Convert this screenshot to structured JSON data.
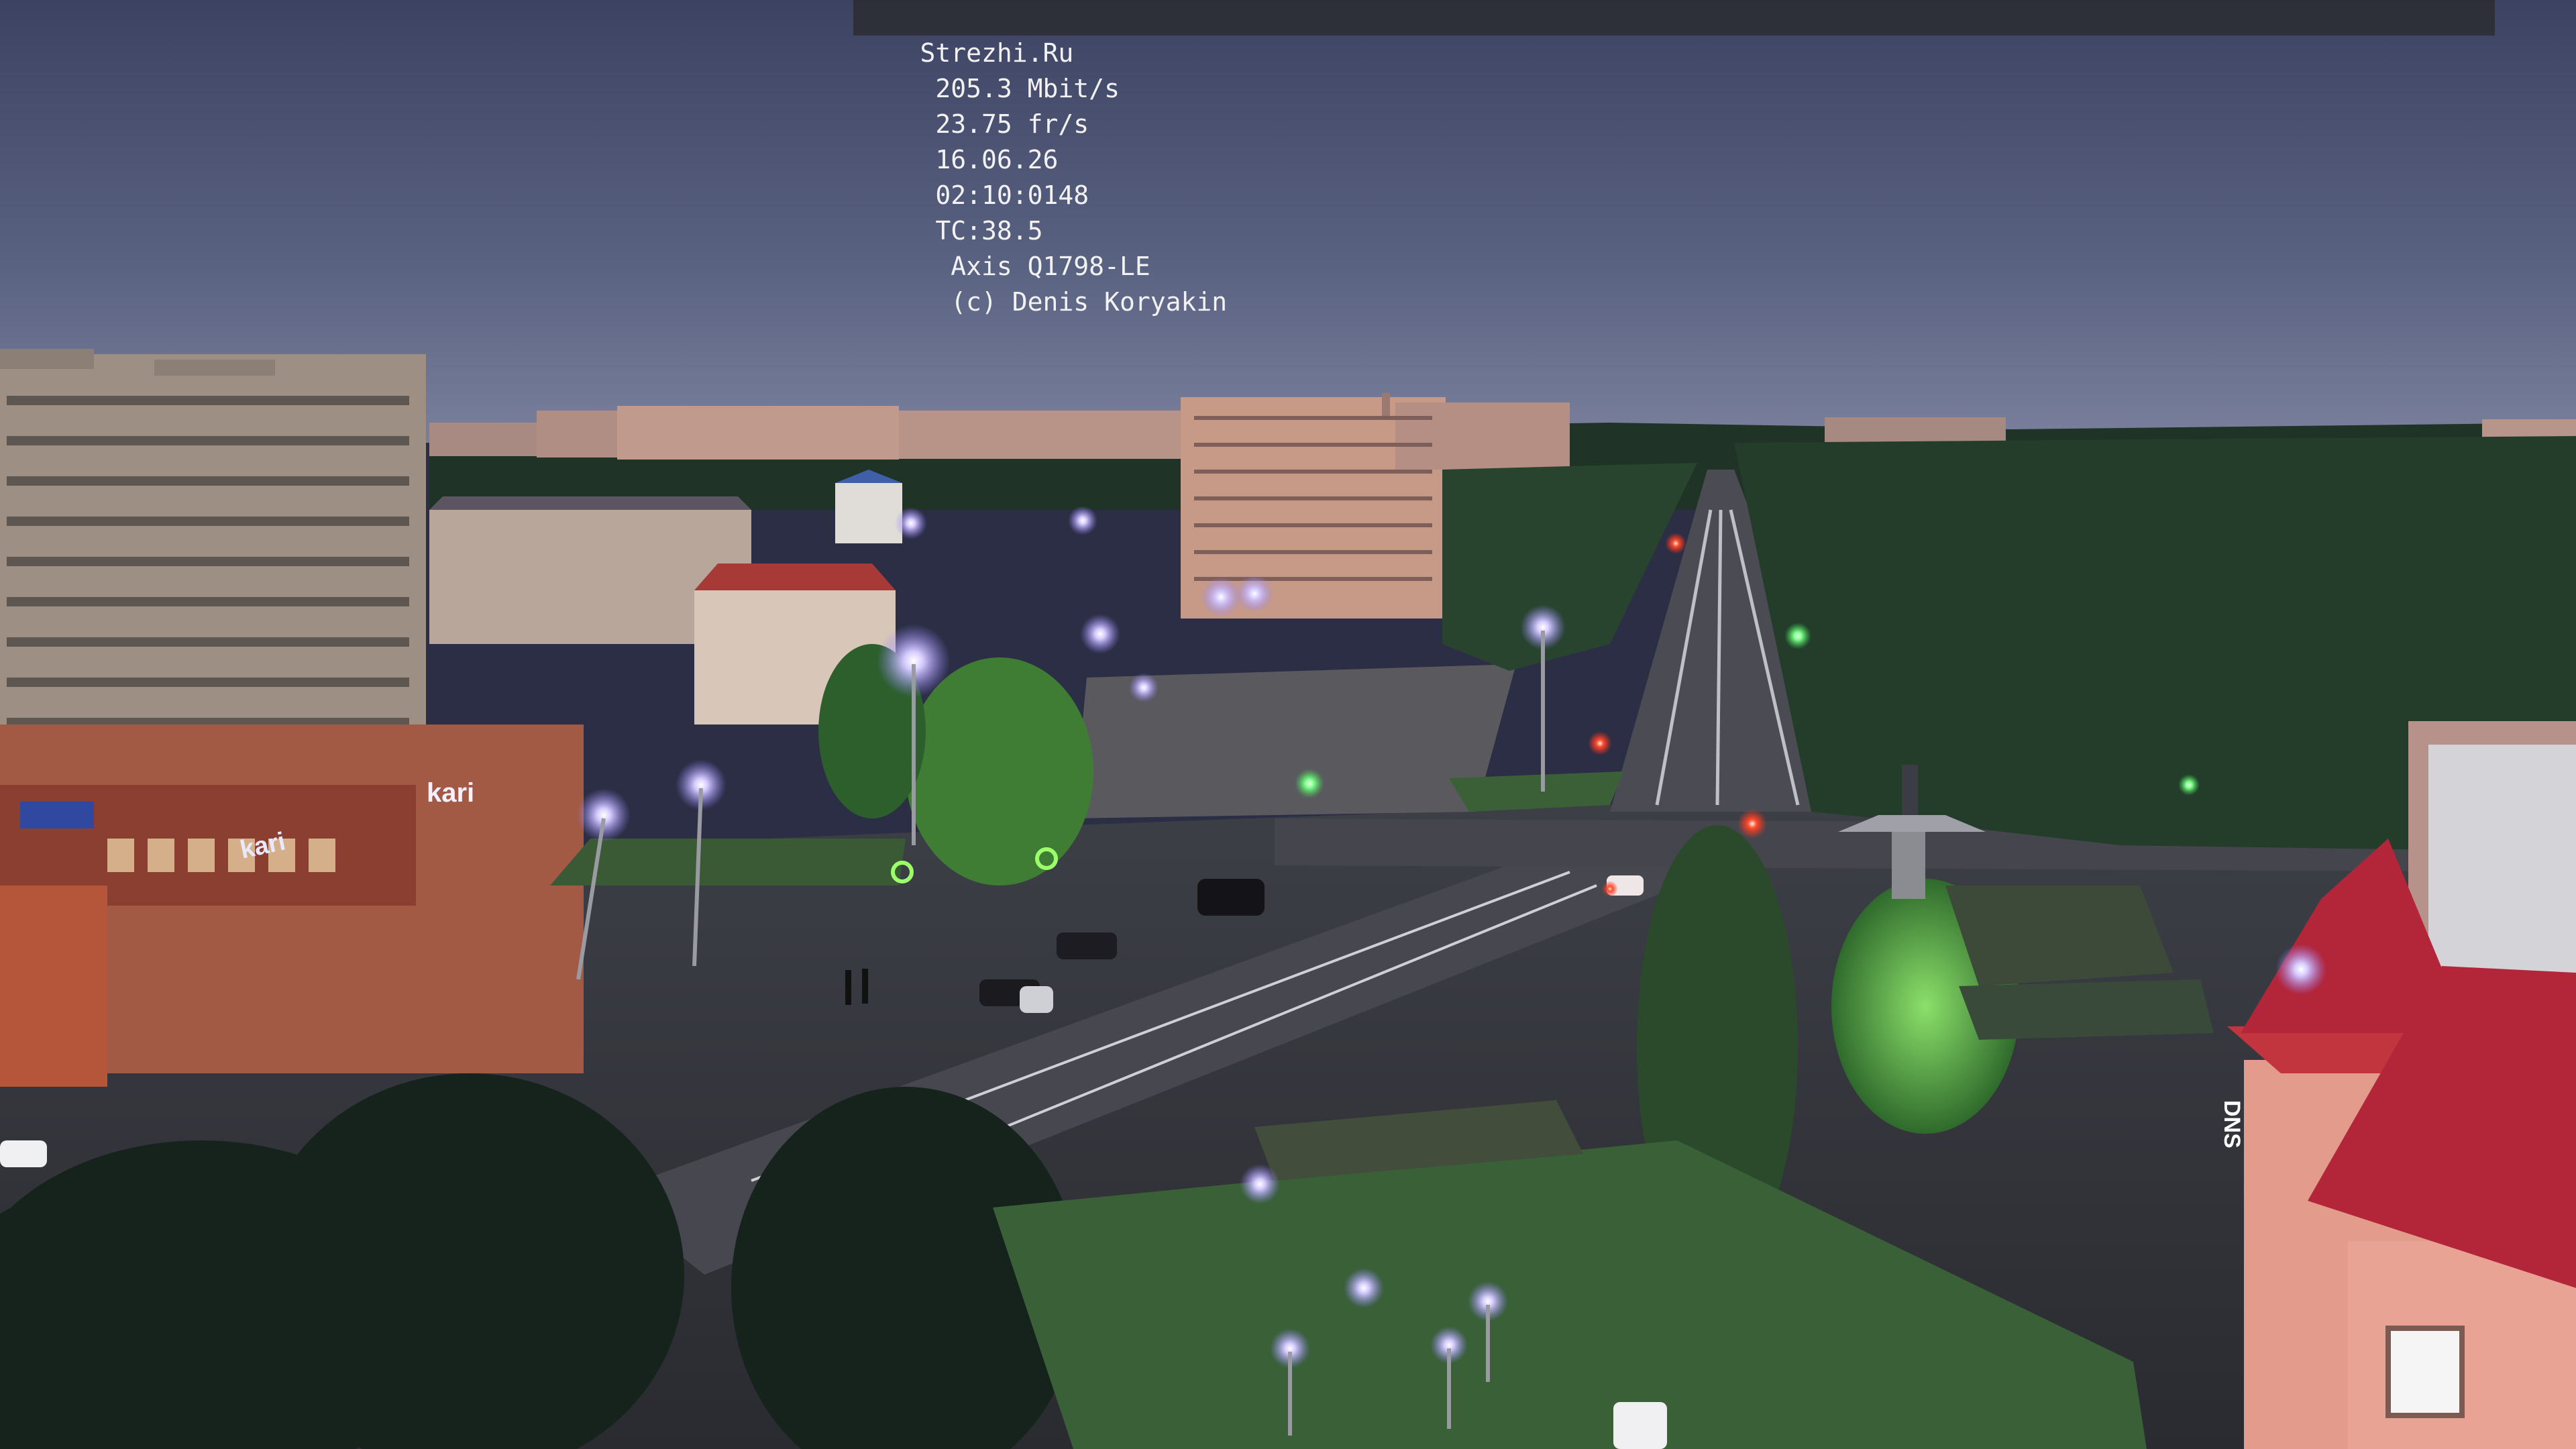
{
  "overlay": {
    "site": "Strezhi.Ru",
    "bitrate": "205.3 Mbit/s",
    "fps": "23.75 fr/s",
    "date": "16.06.26",
    "time": "02:10:0148",
    "tc": "TC:38.5",
    "camera": "Axis Q1798-LE",
    "credit": "(c) Denis Koryakin"
  },
  "signs": {
    "kari_left": "kari",
    "kari_right": "kari",
    "dns": "DNS"
  },
  "colors": {
    "sky_top": "#3f4566",
    "sky_horizon": "#6b7393",
    "lamp_glow": "#b9a8ff",
    "traffic_green": "#36ff7a",
    "traffic_red": "#ff3a2a",
    "roof_red": "#b3263a"
  },
  "icons": {
    "traffic_lights": "traffic-light-icon",
    "street_lamps": "street-lamp-icon"
  }
}
